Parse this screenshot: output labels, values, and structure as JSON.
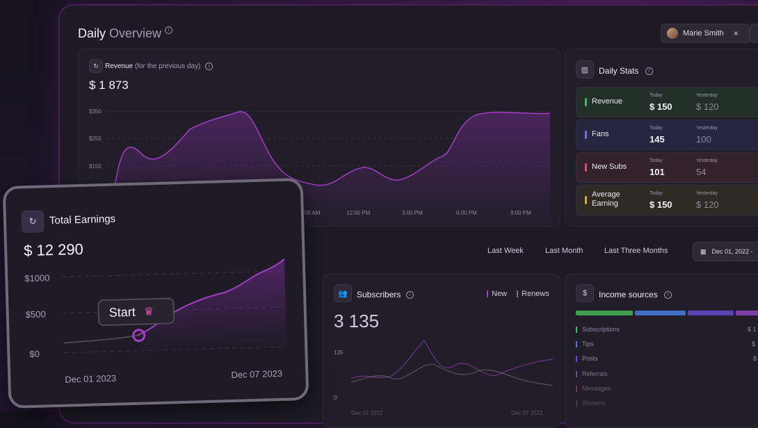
{
  "header": {
    "title_bold": "Daily",
    "title_light": "Overview",
    "info_icon": "info-icon"
  },
  "user_chip": {
    "name": "Marie Smith",
    "close": "×"
  },
  "revenue": {
    "label": "Revenue",
    "sublabel": "(for the previous day)",
    "amount": "$ 1 873",
    "y_ticks": [
      "$350",
      "$250",
      "$150"
    ],
    "x_ticks": [
      "9:00 AM",
      "12:00 PM",
      "3:00 PM",
      "6:00 PM",
      "9:00 PM"
    ]
  },
  "daily_stats": {
    "title": "Daily Stats",
    "today_label": "Today",
    "yesterday_label": "Yesterday",
    "rows": [
      {
        "label": "Revenue",
        "today": "$ 150",
        "yesterday": "$ 120",
        "color": "#3fbf5a"
      },
      {
        "label": "Fans",
        "today": "145",
        "yesterday": "100",
        "color": "#6a6ee8"
      },
      {
        "label": "New Subs",
        "today": "101",
        "yesterday": "54",
        "color": "#e0506b"
      },
      {
        "label": "Average Earning",
        "today": "$ 150",
        "yesterday": "$ 120",
        "color": "#e0a63a"
      }
    ]
  },
  "ranges": {
    "week": "Last Week",
    "month": "Last Month",
    "three_months": "Last Three Months",
    "date": "Dec 01, 2022 -"
  },
  "subscribers": {
    "title": "Subscribers",
    "legend_new": "New",
    "legend_renews": "Renews",
    "count": "3 135",
    "y_ticks": [
      "135",
      "0"
    ],
    "x_ticks": [
      "Dec 01 2022",
      "Dec 07 2022"
    ]
  },
  "income": {
    "title": "Income sources",
    "items": [
      {
        "label": "Subscriptions",
        "value": "$ 1",
        "color": "#3fbf5a"
      },
      {
        "label": "Tips",
        "value": "$",
        "color": "#4f7fd6"
      },
      {
        "label": "Posts",
        "value": "$",
        "color": "#6a4fd0"
      },
      {
        "label": "Referrals",
        "value": "",
        "color": "#8a4fb0"
      },
      {
        "label": "Messages",
        "value": "",
        "color": "#b03f70"
      },
      {
        "label": "Streams",
        "value": "",
        "color": "#b04a3a"
      }
    ]
  },
  "total_earnings": {
    "title": "Total Earnings",
    "amount": "$ 12 290",
    "y_ticks": [
      "$1000",
      "$500",
      "$0"
    ],
    "start_label": "Start",
    "x_start": "Dec 01 2023",
    "x_end": "Dec 07 2023"
  },
  "colors": {
    "accent": "#a33fc6",
    "bg": "#16131f",
    "card": "#211e2a"
  }
}
